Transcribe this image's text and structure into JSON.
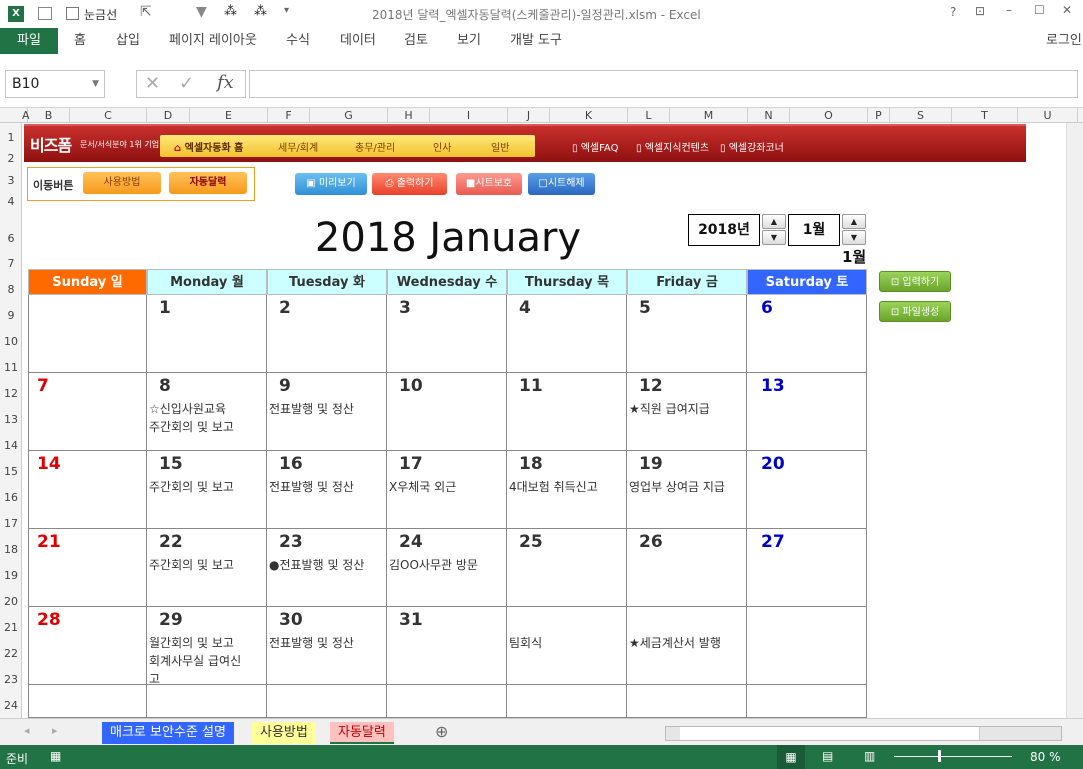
{
  "window": {
    "title": "2018년 달력_엑셀자동달력(스케줄관리)-일정관리.xlsm - Excel",
    "gridlines_label": "눈금선",
    "login": "로그인"
  },
  "ribbon": {
    "tabs": [
      "파일",
      "홈",
      "삽입",
      "페이지 레이아웃",
      "수식",
      "데이터",
      "검토",
      "보기",
      "개발 도구"
    ]
  },
  "formula_bar": {
    "name_box": "B10",
    "formula": ""
  },
  "columns": [
    "A",
    "B",
    "C",
    "D",
    "E",
    "F",
    "G",
    "H",
    "I",
    "J",
    "K",
    "L",
    "M",
    "N",
    "O",
    "P",
    "S",
    "T",
    "U"
  ],
  "rows": [
    "1",
    "2",
    "3",
    "4",
    "6",
    "7",
    "8",
    "9",
    "10",
    "11",
    "12",
    "13",
    "14",
    "15",
    "16",
    "17",
    "18",
    "19",
    "20",
    "21",
    "22",
    "23",
    "24"
  ],
  "banner": {
    "logo": "비즈폼",
    "tagline": "문서/서식분야 1위 기업",
    "nav": [
      "엑셀자동화 홈",
      "세무/회계",
      "총무/관리",
      "인사",
      "일반"
    ],
    "links": [
      "엑셀FAQ",
      "엑셀지식컨텐츠",
      "엑셀강좌코너"
    ]
  },
  "controls": {
    "move_label": "이동버튼",
    "usage": "사용방법",
    "auto_cal": "자동달력",
    "preview": "미리보기",
    "print": "출력하기",
    "protect": "시트보호",
    "unprotect": "시트해제",
    "year": "2018년",
    "month": "1월",
    "month_label": "1월",
    "input": "입력하기",
    "file_create": "파일생성"
  },
  "calendar": {
    "title": "2018 January",
    "day_headers": [
      "Sunday 일",
      "Monday 월",
      "Tuesday 화",
      "Wednesday 수",
      "Thursday 목",
      "Friday 금",
      "Saturday 토"
    ],
    "header_colors": [
      "#ff6a00",
      "#ccffff",
      "#ccffff",
      "#ccffff",
      "#ccffff",
      "#ccffff",
      "#3366ff"
    ],
    "weeks": [
      [
        {
          "d": "",
          "e": []
        },
        {
          "d": "1",
          "e": []
        },
        {
          "d": "2",
          "e": []
        },
        {
          "d": "3",
          "e": []
        },
        {
          "d": "4",
          "e": []
        },
        {
          "d": "5",
          "e": []
        },
        {
          "d": "6",
          "e": []
        }
      ],
      [
        {
          "d": "7",
          "e": []
        },
        {
          "d": "8",
          "e": [
            "☆신입사원교육",
            "주간회의 및 보고"
          ]
        },
        {
          "d": "9",
          "e": [
            "전표발행 및 정산"
          ]
        },
        {
          "d": "10",
          "e": []
        },
        {
          "d": "11",
          "e": []
        },
        {
          "d": "12",
          "e": [
            "★직원 급여지급"
          ]
        },
        {
          "d": "13",
          "e": []
        }
      ],
      [
        {
          "d": "14",
          "e": []
        },
        {
          "d": "15",
          "e": [
            "주간회의 및 보고"
          ]
        },
        {
          "d": "16",
          "e": [
            "전표발행 및 정산"
          ]
        },
        {
          "d": "17",
          "e": [
            "X우체국 외근"
          ]
        },
        {
          "d": "18",
          "e": [
            "4대보험 취득신고"
          ]
        },
        {
          "d": "19",
          "e": [
            "영업부 상여금 지급"
          ]
        },
        {
          "d": "20",
          "e": []
        }
      ],
      [
        {
          "d": "21",
          "e": []
        },
        {
          "d": "22",
          "e": [
            "주간회의 및 보고"
          ]
        },
        {
          "d": "23",
          "e": [
            "●전표발행 및 정산"
          ]
        },
        {
          "d": "24",
          "e": [
            "김OO사무관 방문"
          ]
        },
        {
          "d": "25",
          "e": []
        },
        {
          "d": "26",
          "e": []
        },
        {
          "d": "27",
          "e": []
        }
      ],
      [
        {
          "d": "28",
          "e": []
        },
        {
          "d": "29",
          "e": [
            "월간회의 및 보고",
            "회계사무실 급여신",
            "고"
          ]
        },
        {
          "d": "30",
          "e": [
            "전표발행 및 정산"
          ]
        },
        {
          "d": "31",
          "e": []
        },
        {
          "d": "",
          "e": [
            "팀회식"
          ]
        },
        {
          "d": "",
          "e": [
            "★세금계산서 발행"
          ]
        },
        {
          "d": "",
          "e": []
        }
      ],
      [
        {
          "d": "",
          "e": []
        },
        {
          "d": "",
          "e": []
        },
        {
          "d": "",
          "e": []
        },
        {
          "d": "",
          "e": []
        },
        {
          "d": "",
          "e": []
        },
        {
          "d": "",
          "e": []
        },
        {
          "d": "",
          "e": []
        }
      ]
    ]
  },
  "sheets": [
    {
      "label": "매크로 보안수준 설명",
      "bg": "#3366ff",
      "fg": "#ffffff"
    },
    {
      "label": "사용방법",
      "bg": "#ffff99",
      "fg": "#333333"
    },
    {
      "label": "자동달력",
      "bg": "#ffc0c0",
      "fg": "#c00000"
    }
  ],
  "status": {
    "ready": "준비",
    "zoom": "80 %"
  }
}
